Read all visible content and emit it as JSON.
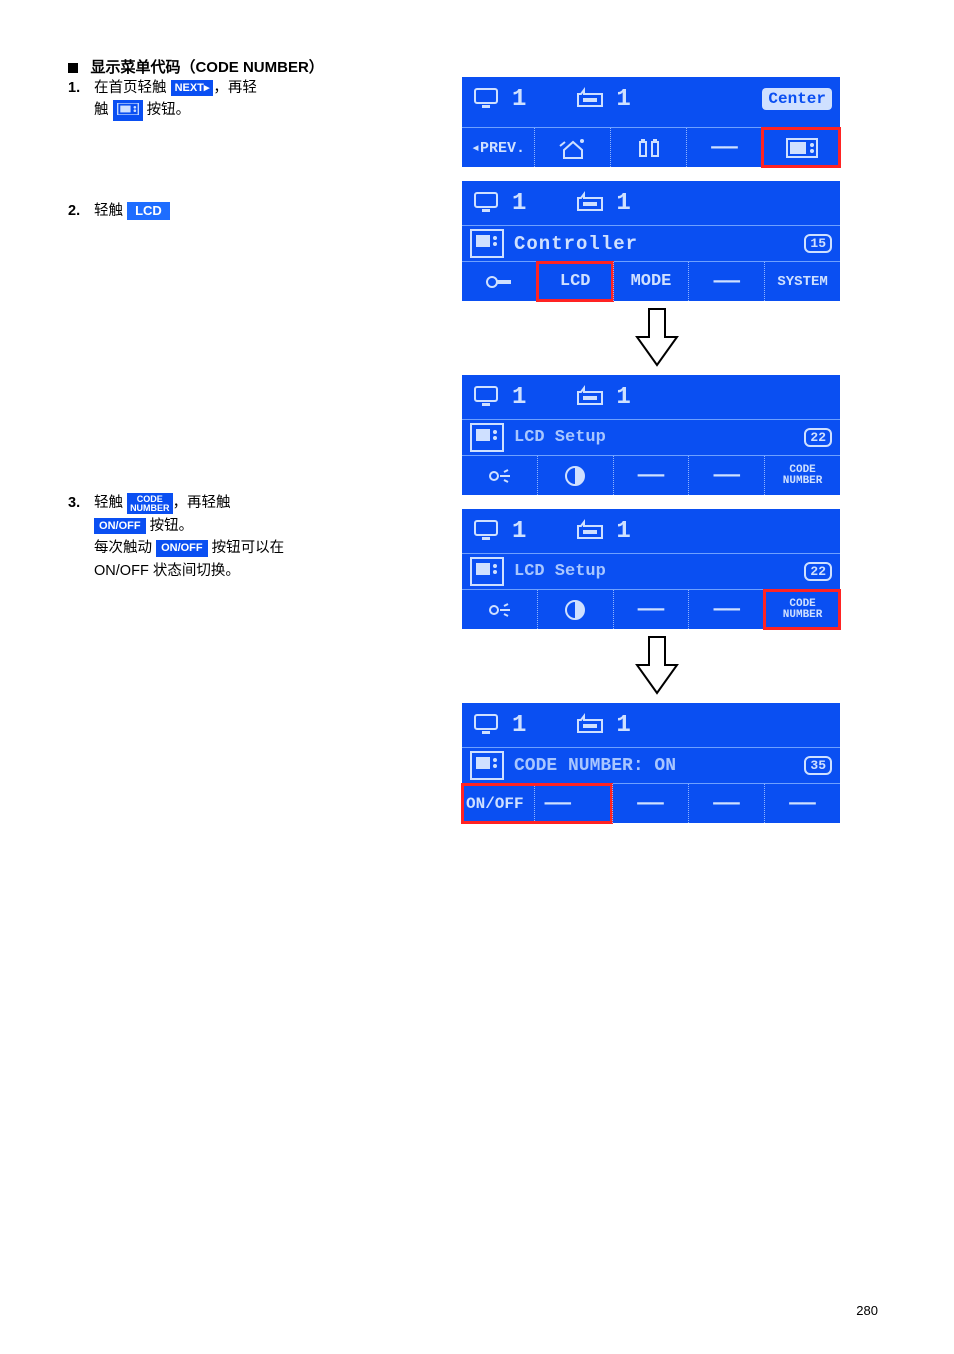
{
  "section": {
    "title": "显示菜单代码（CODE NUMBER）"
  },
  "steps": {
    "s1": {
      "num": "1.",
      "t1": "在首页轻触",
      "next_chip": "NEXT▸",
      "t2": "，再轻",
      "t3": "触",
      "t4": "按钮。"
    },
    "s2": {
      "num": "2.",
      "t1": "轻触",
      "lcd_chip": "LCD"
    },
    "s3": {
      "num": "3.",
      "t1": "轻触",
      "code_top": "CODE",
      "code_bot": "NUMBER",
      "t2": "，再轻触",
      "onoff1": "ON/OFF",
      "t3": "按钮。",
      "t4": "每次触动",
      "onoff2": "ON/OFF",
      "t5": "按钮可以在",
      "t6": "ON/OFF 状态间切换。"
    }
  },
  "screens": {
    "a": {
      "top_num1": "1",
      "top_num2": "1",
      "center": "Center",
      "prev": "◂PREV.",
      "dash": "——"
    },
    "b": {
      "top_num1": "1",
      "top_num2": "1",
      "title": "Controller",
      "page": "15",
      "opt_lcd": "LCD",
      "opt_mode": "MODE",
      "opt_dash": "——",
      "opt_system": "SYSTEM"
    },
    "c": {
      "top_num1": "1",
      "top_num2": "1",
      "title": "LCD Setup",
      "page": "22",
      "dash": "——",
      "code_top": "CODE",
      "code_bot": "NUMBER"
    },
    "d": {
      "top_num1": "1",
      "top_num2": "1",
      "title": "LCD Setup",
      "page": "22",
      "dash": "——",
      "code_top": "CODE",
      "code_bot": "NUMBER"
    },
    "e": {
      "top_num1": "1",
      "top_num2": "1",
      "title": "CODE NUMBER: ON",
      "page": "35",
      "onoff": "ON/OFF",
      "dash": "——"
    }
  },
  "page_number": "280"
}
